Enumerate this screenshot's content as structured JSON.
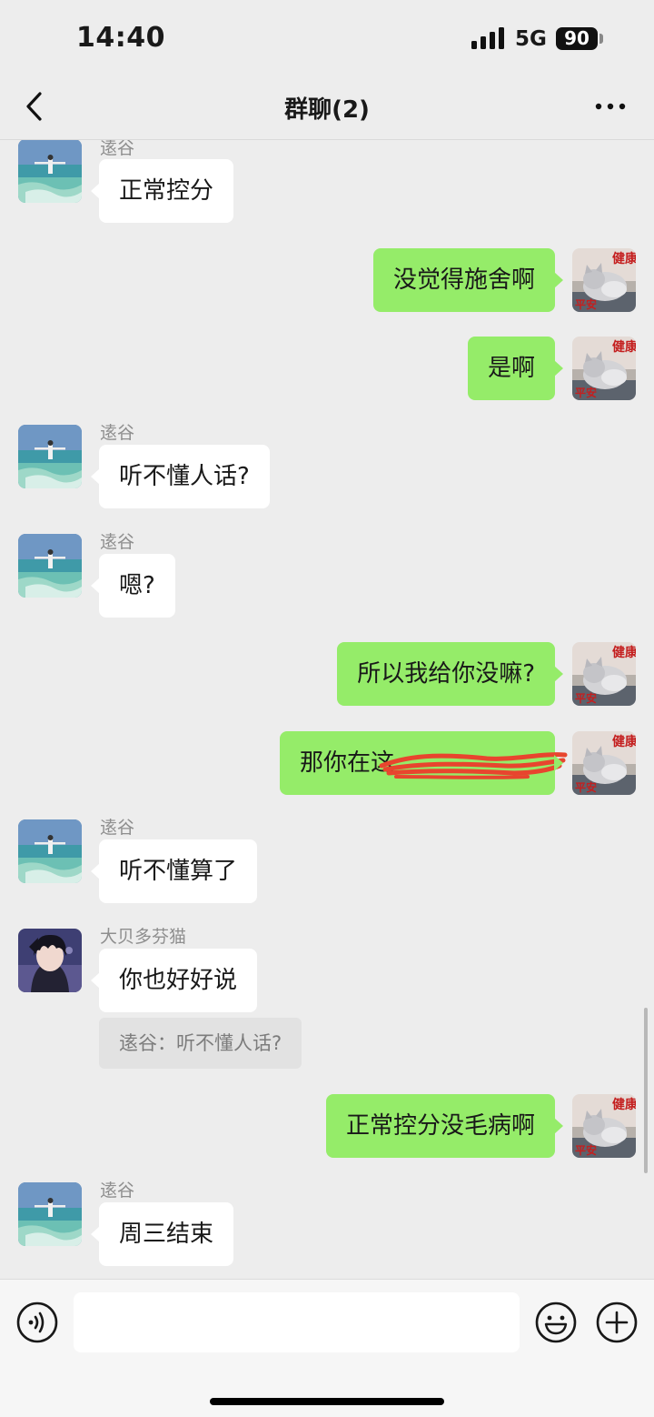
{
  "status_bar": {
    "time": "14:40",
    "network": "5G",
    "battery": "90"
  },
  "nav": {
    "title": "群聊(2)",
    "back_icon": "chevron-left-icon",
    "more_icon": "ellipsis-icon"
  },
  "messages": [
    {
      "sender": "逺谷",
      "text": "正常控分"
    },
    {
      "text": "没觉得施舍啊"
    },
    {
      "text": "是啊"
    },
    {
      "sender": "逺谷",
      "text": "听不懂人话?"
    },
    {
      "sender": "逺谷",
      "text": "嗯?"
    },
    {
      "text": "所以我给你没嘛?"
    },
    {
      "text": "那你在这"
    },
    {
      "sender": "逺谷",
      "text": "听不懂算了"
    },
    {
      "sender": "大贝多芬猫",
      "text": "你也好好说",
      "quote": "逺谷：听不懂人话?"
    },
    {
      "text": "正常控分没毛病啊"
    },
    {
      "sender": "逺谷",
      "text": "周三结束"
    }
  ],
  "input_bar": {
    "voice_icon": "voice-icon",
    "emoji_icon": "emoji-icon",
    "plus_icon": "plus-circle-icon",
    "input_value": ""
  },
  "colors": {
    "background": "#ededed",
    "outgoing_bubble": "#95ec69",
    "incoming_bubble": "#ffffff",
    "redaction": "#e8452e"
  }
}
